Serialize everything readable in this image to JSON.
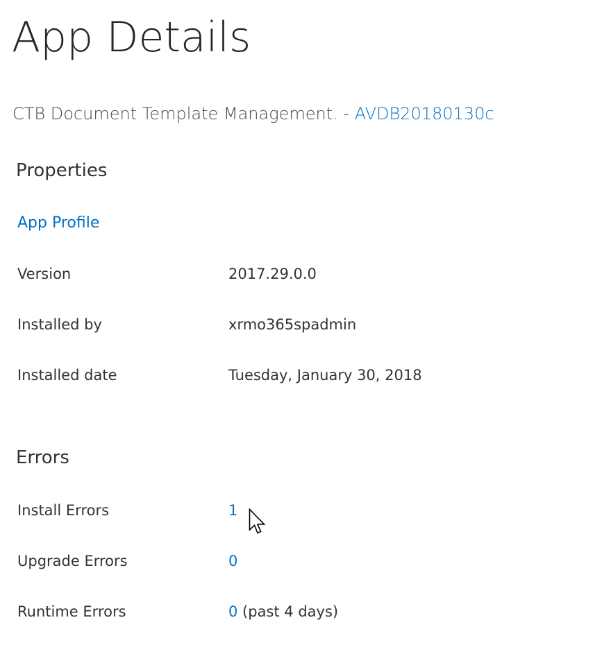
{
  "page": {
    "title": "App Details"
  },
  "app": {
    "name": "CTB Document Template Management.",
    "separator": " - ",
    "site_link": "AVDB20180130c"
  },
  "properties": {
    "heading": "Properties",
    "app_profile_link": "App Profile",
    "rows": [
      {
        "label": "Version",
        "value": "2017.29.0.0"
      },
      {
        "label": "Installed by",
        "value": "xrmo365spadmin"
      },
      {
        "label": "Installed date",
        "value": "Tuesday, January 30, 2018"
      }
    ]
  },
  "errors": {
    "heading": "Errors",
    "rows": [
      {
        "label": "Install Errors",
        "value": "1",
        "suffix": ""
      },
      {
        "label": "Upgrade Errors",
        "value": "0",
        "suffix": ""
      },
      {
        "label": "Runtime Errors",
        "value": "0",
        "suffix": " (past 4 days)"
      }
    ]
  },
  "icons": {
    "cursor": "mouse-pointer-icon"
  },
  "colors": {
    "link": "#0072c6",
    "text": "#333333",
    "title": "#262626"
  }
}
